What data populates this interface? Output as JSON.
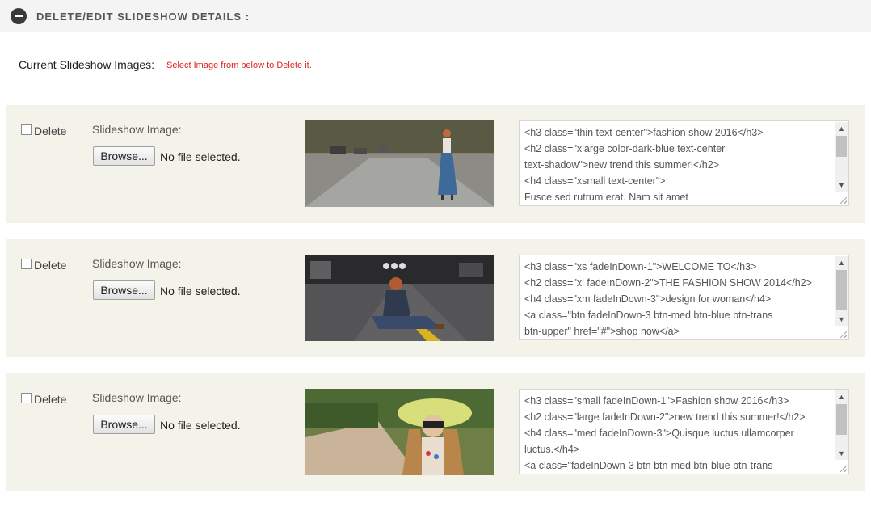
{
  "header": {
    "title": "DELETE/EDIT SLIDESHOW DETAILS :",
    "collapse_icon": "minus-circle-icon"
  },
  "current_label": "Current Slideshow Images:",
  "hint": "Select Image from below to Delete it.",
  "colors": {
    "hint": "#e02020",
    "row_background": "#f4f3ea",
    "header_background": "#f4f4f4"
  },
  "slides": [
    {
      "delete_label": "Delete",
      "image_label": "Slideshow Image:",
      "browse_label": "Browse...",
      "file_status": "No file selected.",
      "code": "<h3 class=\"thin text-center\">fashion show 2016</h3>\n<h2 class=\"xlarge color-dark-blue text-center\ntext-shadow\">new trend this summer!</h2>\n<h4 class=\"xsmall text-center\">\nFusce sed rutrum erat. Nam sit amet"
    },
    {
      "delete_label": "Delete",
      "image_label": "Slideshow Image:",
      "browse_label": "Browse...",
      "file_status": "No file selected.",
      "code": "<h3 class=\"xs fadeInDown-1\">WELCOME TO</h3>\n<h2 class=\"xl fadeInDown-2\">THE FASHION SHOW 2014</h2>\n<h4 class=\"xm fadeInDown-3\">design for woman</h4>\n<a class=\"btn fadeInDown-3 btn-med btn-blue btn-trans\nbtn-upper\" href=\"#\">shop now</a>"
    },
    {
      "delete_label": "Delete",
      "image_label": "Slideshow Image:",
      "browse_label": "Browse...",
      "file_status": "No file selected.",
      "code": "<h3 class=\"small fadeInDown-1\">Fashion show 2016</h3>\n<h2 class=\"large fadeInDown-2\">new trend this summer!</h2>\n<h4 class=\"med fadeInDown-3\">Quisque luctus ullamcorper\nluctus.</h4>\n<a class=\"fadeInDown-3 btn btn-med btn-blue btn-trans"
    }
  ]
}
